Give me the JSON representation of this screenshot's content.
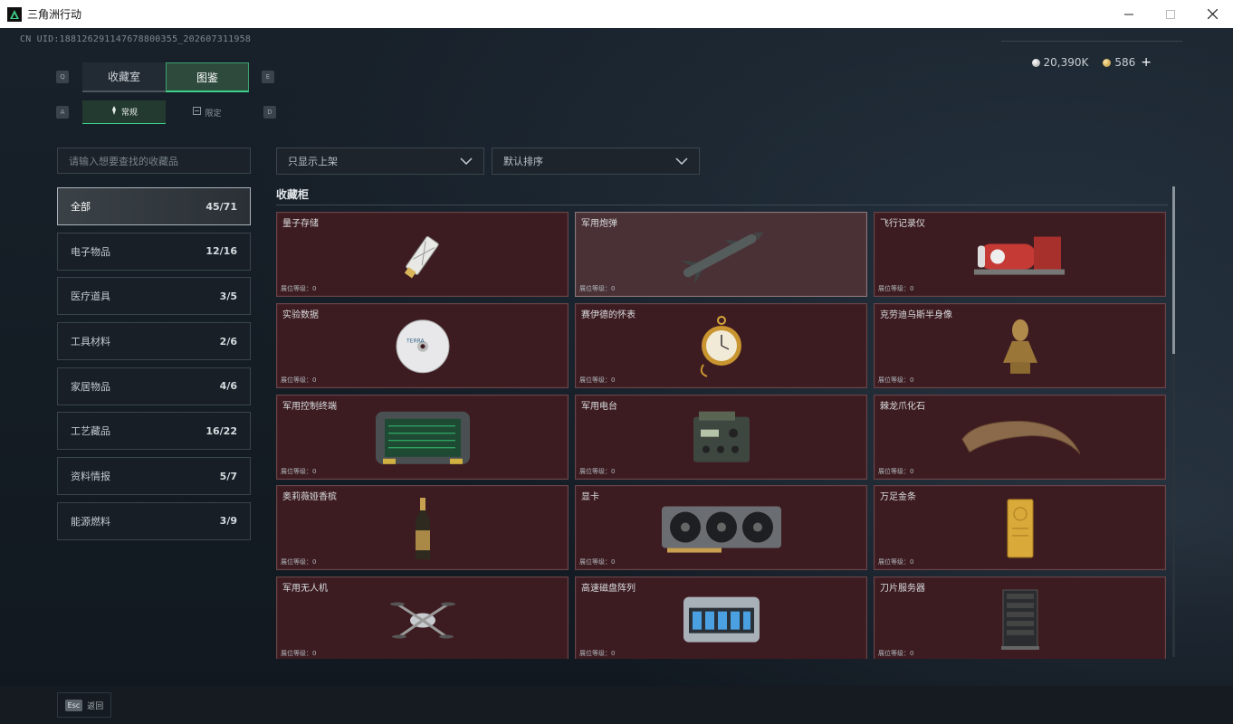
{
  "window": {
    "title": "三角洲行动"
  },
  "header": {
    "uid": "CN UID:188126291147678800355_202607311958",
    "currency": [
      {
        "icon": "silver-coin-icon",
        "value": "20,390K"
      },
      {
        "icon": "gold-coin-icon",
        "value": "586"
      }
    ]
  },
  "keys": {
    "prev_tab": "Q",
    "next_tab": "E",
    "prev_sub": "A",
    "next_sub": "D"
  },
  "tabs": [
    {
      "label": "收藏室"
    },
    {
      "label": "图鉴",
      "active": true
    }
  ],
  "subtabs": [
    {
      "label": "常规",
      "active": true
    },
    {
      "label": "限定"
    }
  ],
  "search": {
    "placeholder": "请输入想要查找的收藏品"
  },
  "filters": {
    "shelf_filter": "只显示上架",
    "sort": "默认排序"
  },
  "categories": [
    {
      "label": "全部",
      "count": "45/71",
      "active": true
    },
    {
      "label": "电子物品",
      "count": "12/16"
    },
    {
      "label": "医疗道具",
      "count": "3/5"
    },
    {
      "label": "工具材料",
      "count": "2/6"
    },
    {
      "label": "家居物品",
      "count": "4/6"
    },
    {
      "label": "工艺藏品",
      "count": "16/22"
    },
    {
      "label": "资料情报",
      "count": "5/7"
    },
    {
      "label": "能源燃料",
      "count": "3/9"
    }
  ],
  "cabinet": {
    "title": "收藏柜",
    "items": [
      {
        "name": "量子存储",
        "level": "展位等级：0",
        "icon": "usb-drive-icon"
      },
      {
        "name": "军用炮弹",
        "level": "展位等级：0",
        "icon": "missile-icon",
        "selected": true
      },
      {
        "name": "飞行记录仪",
        "level": "展位等级：0",
        "icon": "flight-recorder-icon"
      },
      {
        "name": "实验数据",
        "level": "展位等级：0",
        "icon": "disc-icon"
      },
      {
        "name": "赛伊德的怀表",
        "level": "展位等级：0",
        "icon": "pocket-watch-icon"
      },
      {
        "name": "克劳迪乌斯半身像",
        "level": "展位等级：0",
        "icon": "bust-icon"
      },
      {
        "name": "军用控制终端",
        "level": "展位等级：0",
        "icon": "terminal-icon"
      },
      {
        "name": "军用电台",
        "level": "展位等级：0",
        "icon": "radio-icon"
      },
      {
        "name": "棘龙爪化石",
        "level": "展位等级：0",
        "icon": "claw-fossil-icon"
      },
      {
        "name": "奥莉薇娅香槟",
        "level": "展位等级：0",
        "icon": "champagne-icon"
      },
      {
        "name": "显卡",
        "level": "展位等级：0",
        "icon": "gpu-icon"
      },
      {
        "name": "万足金条",
        "level": "展位等级：0",
        "icon": "gold-bar-icon"
      },
      {
        "name": "军用无人机",
        "level": "展位等级：0",
        "icon": "drone-icon"
      },
      {
        "name": "高速磁盘阵列",
        "level": "展位等级：0",
        "icon": "disk-array-icon"
      },
      {
        "name": "刀片服务器",
        "level": "展位等级：0",
        "icon": "blade-server-icon"
      }
    ]
  },
  "footer": {
    "esc_key": "Esc",
    "back_label": "返回"
  }
}
